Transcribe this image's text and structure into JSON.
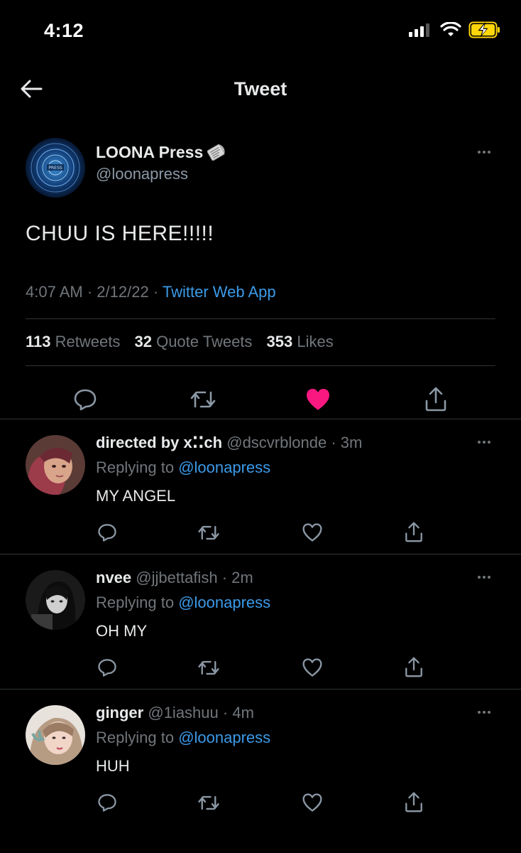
{
  "status_bar": {
    "time": "4:12"
  },
  "nav": {
    "title": "Tweet"
  },
  "tweet": {
    "author_name": "LOONA Press",
    "author_handle": "@loonapress",
    "avatar_text": "PRESS",
    "text": "CHUU IS HERE!!!!!",
    "time": "4:07 AM",
    "date": "2/12/22",
    "source": "Twitter Web App",
    "separator": "·",
    "stats": {
      "retweets_count": "113",
      "retweets_label": "Retweets",
      "quotes_count": "32",
      "quotes_label": "Quote Tweets",
      "likes_count": "353",
      "likes_label": "Likes"
    },
    "liked": true,
    "like_color": "#f91880"
  },
  "replies": [
    {
      "name": "directed by x⁚⁚ch",
      "handle": "@dscvrblonde",
      "time": "3m",
      "replying_label": "Replying to",
      "replying_to": "@loonapress",
      "text": "MY ANGEL"
    },
    {
      "name": "nvee",
      "handle": "@jjbettafish",
      "time": "2m",
      "replying_label": "Replying to",
      "replying_to": "@loonapress",
      "text": "OH MY"
    },
    {
      "name": "ginger",
      "handle": "@1iashuu",
      "time": "4m",
      "replying_label": "Replying to",
      "replying_to": "@loonapress",
      "text": "HUH"
    }
  ],
  "colors": {
    "background": "#000000",
    "accent": "#3b9ae8",
    "muted": "#71767b",
    "divider": "#2f3336",
    "battery": "#ffd60a"
  }
}
